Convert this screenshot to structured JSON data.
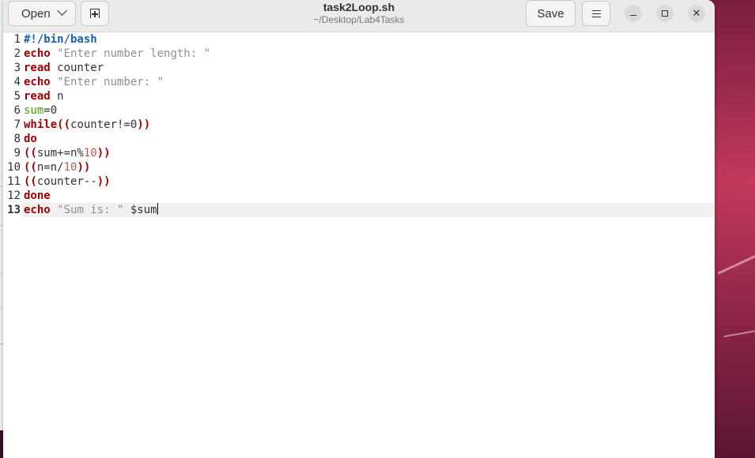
{
  "header": {
    "open_label": "Open",
    "save_label": "Save",
    "title": "task2Loop.sh",
    "subtitle": "~/Desktop/Lab4Tasks"
  },
  "window_controls": {
    "close_glyph": "✕"
  },
  "editor": {
    "current_line": 13,
    "lines": [
      {
        "num": "1",
        "tokens": [
          {
            "t": "#!/bin/bash",
            "c": "pp"
          }
        ]
      },
      {
        "num": "2",
        "tokens": [
          {
            "t": "echo",
            "c": "kw"
          },
          {
            "t": " ",
            "c": ""
          },
          {
            "t": "\"Enter number length: \"",
            "c": "str"
          }
        ]
      },
      {
        "num": "3",
        "tokens": [
          {
            "t": "read",
            "c": "kw"
          },
          {
            "t": " counter",
            "c": ""
          }
        ]
      },
      {
        "num": "4",
        "tokens": [
          {
            "t": "echo",
            "c": "kw"
          },
          {
            "t": " ",
            "c": ""
          },
          {
            "t": "\"Enter number: \"",
            "c": "str"
          }
        ]
      },
      {
        "num": "5",
        "tokens": [
          {
            "t": "read",
            "c": "kw"
          },
          {
            "t": " n",
            "c": ""
          }
        ]
      },
      {
        "num": "6",
        "tokens": [
          {
            "t": "sum",
            "c": "var"
          },
          {
            "t": "=0",
            "c": ""
          }
        ]
      },
      {
        "num": "7",
        "tokens": [
          {
            "t": "while",
            "c": "kw"
          },
          {
            "t": "((",
            "c": "paren"
          },
          {
            "t": "counter!=0",
            "c": ""
          },
          {
            "t": "))",
            "c": "paren"
          }
        ]
      },
      {
        "num": "8",
        "tokens": [
          {
            "t": "do",
            "c": "kw"
          }
        ]
      },
      {
        "num": "9",
        "tokens": [
          {
            "t": "((",
            "c": "paren"
          },
          {
            "t": "sum+=n%",
            "c": ""
          },
          {
            "t": "10",
            "c": "num"
          },
          {
            "t": "))",
            "c": "paren"
          }
        ]
      },
      {
        "num": "10",
        "tokens": [
          {
            "t": "((",
            "c": "paren"
          },
          {
            "t": "n=n/",
            "c": ""
          },
          {
            "t": "10",
            "c": "num"
          },
          {
            "t": "))",
            "c": "paren"
          }
        ]
      },
      {
        "num": "11",
        "tokens": [
          {
            "t": "((",
            "c": "paren"
          },
          {
            "t": "counter--",
            "c": ""
          },
          {
            "t": "))",
            "c": "paren"
          }
        ]
      },
      {
        "num": "12",
        "tokens": [
          {
            "t": "done",
            "c": "kw"
          }
        ]
      },
      {
        "num": "13",
        "tokens": [
          {
            "t": "echo",
            "c": "kw"
          },
          {
            "t": " ",
            "c": ""
          },
          {
            "t": "\"Sum is: \"",
            "c": "str"
          },
          {
            "t": " $sum",
            "c": ""
          }
        ]
      }
    ]
  },
  "colors": {
    "keyword": "#a40000",
    "shebang": "#1a5fb4",
    "string": "#8f8f8f",
    "number": "#b85c5c",
    "variable": "#4e9a06",
    "current_line_bg": "#f1f0ee"
  }
}
